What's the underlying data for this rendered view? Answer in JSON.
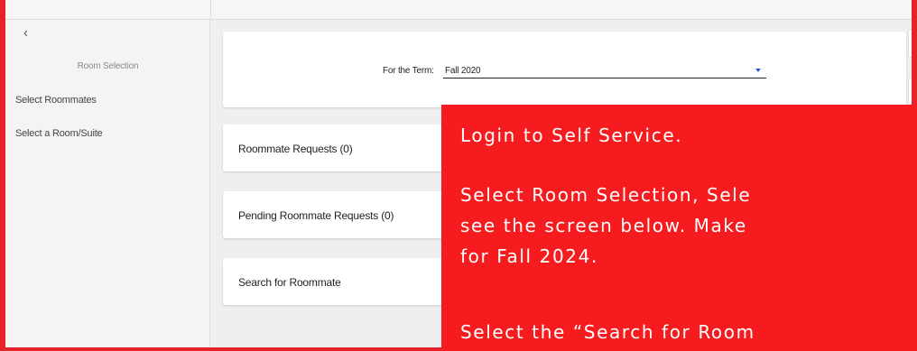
{
  "sidebar": {
    "back_icon": "‹",
    "title": "Room Selection",
    "items": [
      {
        "label": "Select Roommates"
      },
      {
        "label": "Select a Room/Suite"
      }
    ]
  },
  "term": {
    "label": "For the Term:",
    "value": "Fall 2020"
  },
  "cards": [
    {
      "label": "Roommate Requests (0)"
    },
    {
      "label": "Pending Roommate Requests (0)"
    },
    {
      "label": "Search for Roommate"
    }
  ],
  "overlay": {
    "line1": "Login to Self Service.",
    "line2": " Select Room Selection, Sele",
    "line3": "see the screen below. Make",
    "line4": "for Fall 2024.",
    "line5": "Select the “Search for Room"
  },
  "colors": {
    "overlay_bg": "#f51b1e",
    "border": "#e8222a",
    "accent": "#2a5bd7"
  }
}
